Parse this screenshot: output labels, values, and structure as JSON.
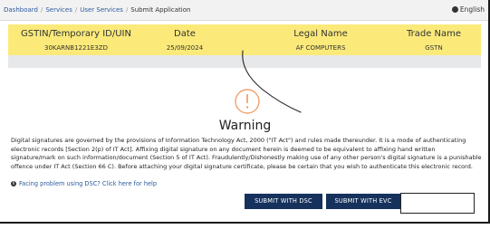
{
  "breadcrumb": {
    "items": [
      "Dashboard",
      "Services",
      "User Services",
      "Submit Application"
    ]
  },
  "language": {
    "label": "English",
    "icon": "globe-icon"
  },
  "info_bar": {
    "columns": [
      {
        "header": "GSTIN/Temporary ID/UIN",
        "value": "30KARNB1221E3ZD"
      },
      {
        "header": "Date",
        "value": "25/09/2024"
      },
      {
        "header": "Legal Name",
        "value": "AF COMPUTERS"
      },
      {
        "header": "Trade Name",
        "value": "GSTN"
      }
    ],
    "background_color": "#fbea7a"
  },
  "warning": {
    "icon": "exclamation-circle-icon",
    "icon_color": "#f0a070",
    "title": "Warning",
    "text": "Digital signatures are governed by the provisions of Information Technology Act, 2000 (\"IT Act\") and rules made thereunder. It is a mode of authenticating electronic records [Section 2(p) of IT Act]. Affixing digital signature on any document herein is deemed to be equivalent to affixing hand written signature/mark on such information/document (Section 5 of IT Act). Fraudulently/Dishonestly making use of any other person's digital signature is a punishable offence under IT Act (Section 66 C). Before attaching your digital signature certificate, please be certain that you wish to authenticate this electronic record."
  },
  "help_link": {
    "label": "Facing problem using DSC? Click here for help",
    "icon": "info-circle-icon"
  },
  "buttons": {
    "dsc": "SUBMIT WITH DSC",
    "evc": "SUBMIT WITH EVC",
    "color": "#16325c"
  }
}
